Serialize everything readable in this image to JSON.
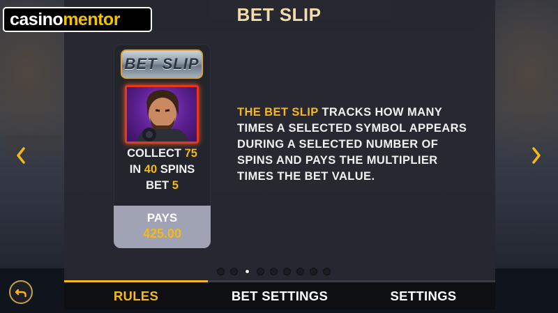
{
  "branding": {
    "part1": "casino",
    "part2": "mentor"
  },
  "title": "BET SLIP",
  "card": {
    "badge": "BET SLIP",
    "collect_prefix": "COLLECT",
    "collect_value": "75",
    "spins_prefix": "IN",
    "spins_value": "40",
    "spins_suffix": "SPINS",
    "bet_prefix": "BET",
    "bet_value": "5",
    "pays_label": "PAYS",
    "pays_value": "425.00"
  },
  "description": {
    "highlight": "THE BET SLIP",
    "rest_line1": "TRACKS HOW MANY",
    "line2": "TIMES A SELECTED SYMBOL APPEARS",
    "line3": "DURING A SELECTED NUMBER OF",
    "line4": "SPINS AND PAYS THE MULTIPLIER",
    "line5": "TIMES THE BET VALUE."
  },
  "pagination": {
    "total_pages": 9,
    "active_page": 2
  },
  "tabs": [
    {
      "label": "RULES",
      "active": true
    },
    {
      "label": "BET SETTINGS",
      "active": false
    },
    {
      "label": "SETTINGS",
      "active": false
    }
  ],
  "icons": {
    "prev": "chevron-left-icon",
    "next": "chevron-right-icon",
    "back": "back-arrow-icon"
  },
  "colors": {
    "accent": "#f5b81a",
    "title": "#f3dbaa",
    "panel": "#262830",
    "symbol_border": "#e8371f"
  }
}
